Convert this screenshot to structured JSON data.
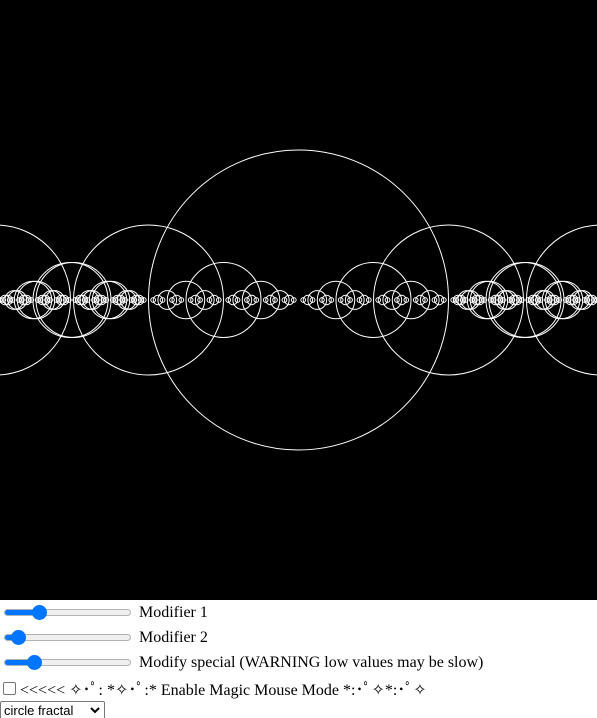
{
  "controls": {
    "modifier1": {
      "label": "Modifier 1",
      "value": 0.25
    },
    "modifier2": {
      "label": "Modifier 2",
      "value": 0.06
    },
    "modify_special": {
      "label": "Modify special (WARNING low values may be slow)",
      "value": 0.2
    },
    "magic_mouse": {
      "label": "<<<<< ✧･ﾟ: *✧･ﾟ:* Enable Magic Mouse Mode *:･ﾟ✧*:･ﾟ✧",
      "checked": false
    },
    "mode_select": {
      "selected": "circle fractal"
    }
  },
  "colors": {
    "canvas_background": "#000000",
    "circle_stroke": "#ffffff",
    "slider_accent": "#0075ff"
  }
}
